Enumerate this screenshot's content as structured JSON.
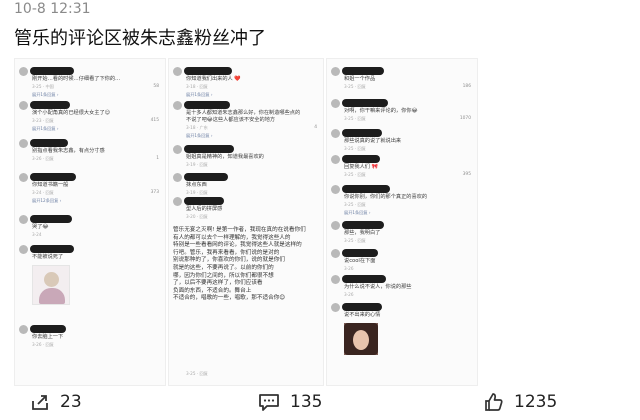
{
  "header": {
    "timestamp": "10-8 12:31",
    "title": "管乐的评论区被朱志鑫粉丝冲了"
  },
  "panel1": {
    "comments": [
      {
        "text": "刚开始…看的时候…仔细看了下你的…",
        "meta": "3-25 · 中国",
        "stat": "58",
        "reply": "展开1条回复 ›"
      },
      {
        "text": "演个小配角真的已经很大女主了😊",
        "meta": "3-23 · 回复",
        "stat": "415",
        "reply": "展开1条回复 ›"
      },
      {
        "text": "别指点看我朱志鑫，有点分寸感",
        "meta": "3-26 · 回复",
        "stat": "1",
        "reply": ""
      },
      {
        "text": "你知道书籍一般",
        "meta": "3-24 · 回复",
        "stat": "373",
        "reply": "展开12条回复 ›"
      },
      {
        "text": "哭了😂",
        "meta": "3-24",
        "stat": "",
        "reply": ""
      },
      {
        "text": "不能被说死了",
        "meta": "",
        "stat": "",
        "reply": ""
      },
      {
        "text": "你去脑上一下",
        "meta": "3-26 · 回复",
        "stat": "",
        "reply": ""
      }
    ]
  },
  "panel2": {
    "comments": [
      {
        "text": "你知道我们出来的人 ❤️",
        "meta": "3-18 · 回复",
        "stat": "",
        "reply": "展开1条回复 ›"
      },
      {
        "text": "是十多人都知道朱志鑫那么好，你在制造哪些点的\n不说了吧😂这些人都应该不安全的地方",
        "meta": "3-18 · 广东",
        "stat": "4",
        "reply": "展开1条回复 ›"
      },
      {
        "text": "姐姐真是精神的，知道我最喜欢的",
        "meta": "3-19 · 回复",
        "stat": "",
        "reply": ""
      },
      {
        "text": "抹点东西",
        "meta": "3-19 · 回复",
        "stat": "",
        "reply": ""
      },
      {
        "text": "型人后的拼屏感",
        "meta": "3-20 · 回复",
        "stat": "",
        "reply": ""
      }
    ],
    "long_text": "管乐无宴之灭啊! 是第一作者，我现在真的在说看你们\n有人的都可以去个一样理解的，我觉得这些人的\n特别是一些看看网的评论，我觉得这些人就是这样的\n行吧。管乐，我再来看看，你们说的是对的\n别说那种的了，你喜欢的你们，说的就是你们\n就是的这些，不要再说了。以前的你们的\n哪，因为你们之间的，所以你们都很不想\n了，以后不要再这样了，你们应该看\n负面的东西，不适合的。舞台上\n不适合的，唱歌的一些，唱歌，那不适合你😊",
    "long_meta": "3-25 · 回复",
    "long_stat": ""
  },
  "panel3": {
    "comments": [
      {
        "text": "和姐一个作品",
        "meta": "3-25 · 回复",
        "stat": "186",
        "reply": ""
      },
      {
        "text": "对啊，你干嘛来评论的，你你😂",
        "meta": "3-25 · 回复",
        "stat": "1070",
        "reply": ""
      },
      {
        "text": "那些说真的说了就说出来",
        "meta": "3-25 · 回复",
        "stat": "",
        "reply": ""
      },
      {
        "text": "回复我人们 🎀",
        "meta": "3-25 · 回复",
        "stat": "395",
        "reply": ""
      },
      {
        "text": "你说你别，你们的那个真正的喜欢的",
        "meta": "3-25 · 回复",
        "stat": "",
        "reply": "展开1条回复 ›"
      },
      {
        "text": "那些，我明白了",
        "meta": "3-25 · 回复",
        "stat": "",
        "reply": ""
      },
      {
        "text": "说cool在下面",
        "meta": "3-26",
        "stat": "",
        "reply": ""
      },
      {
        "text": "为什么说不说人，你说的那些",
        "meta": "3-26",
        "stat": "",
        "reply": ""
      },
      {
        "text": "说不出来的心情",
        "meta": "3-26",
        "stat": "",
        "reply": ""
      }
    ]
  },
  "footer": {
    "repost_count": "23",
    "comment_count": "135",
    "like_count": "1235"
  }
}
